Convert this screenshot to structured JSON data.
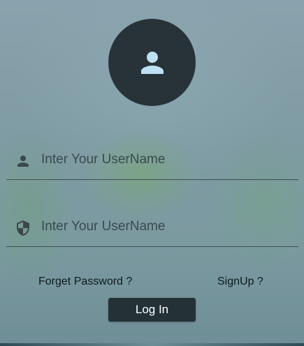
{
  "avatar": {
    "icon": "person-icon"
  },
  "username_field": {
    "icon": "person-icon",
    "placeholder": "Inter Your UserName",
    "value": ""
  },
  "password_field": {
    "icon": "shield-icon",
    "placeholder": "Inter Your UserName",
    "value": ""
  },
  "links": {
    "forgot_password": "Forget Password ?",
    "signup": "SignUp ?"
  },
  "login_button": {
    "label": "Log In"
  },
  "colors": {
    "avatar_bg": "#273338",
    "avatar_icon": "#bfe0f2",
    "button_bg": "#243238",
    "button_text": "#ffffff",
    "underline": "#3f4f55"
  }
}
